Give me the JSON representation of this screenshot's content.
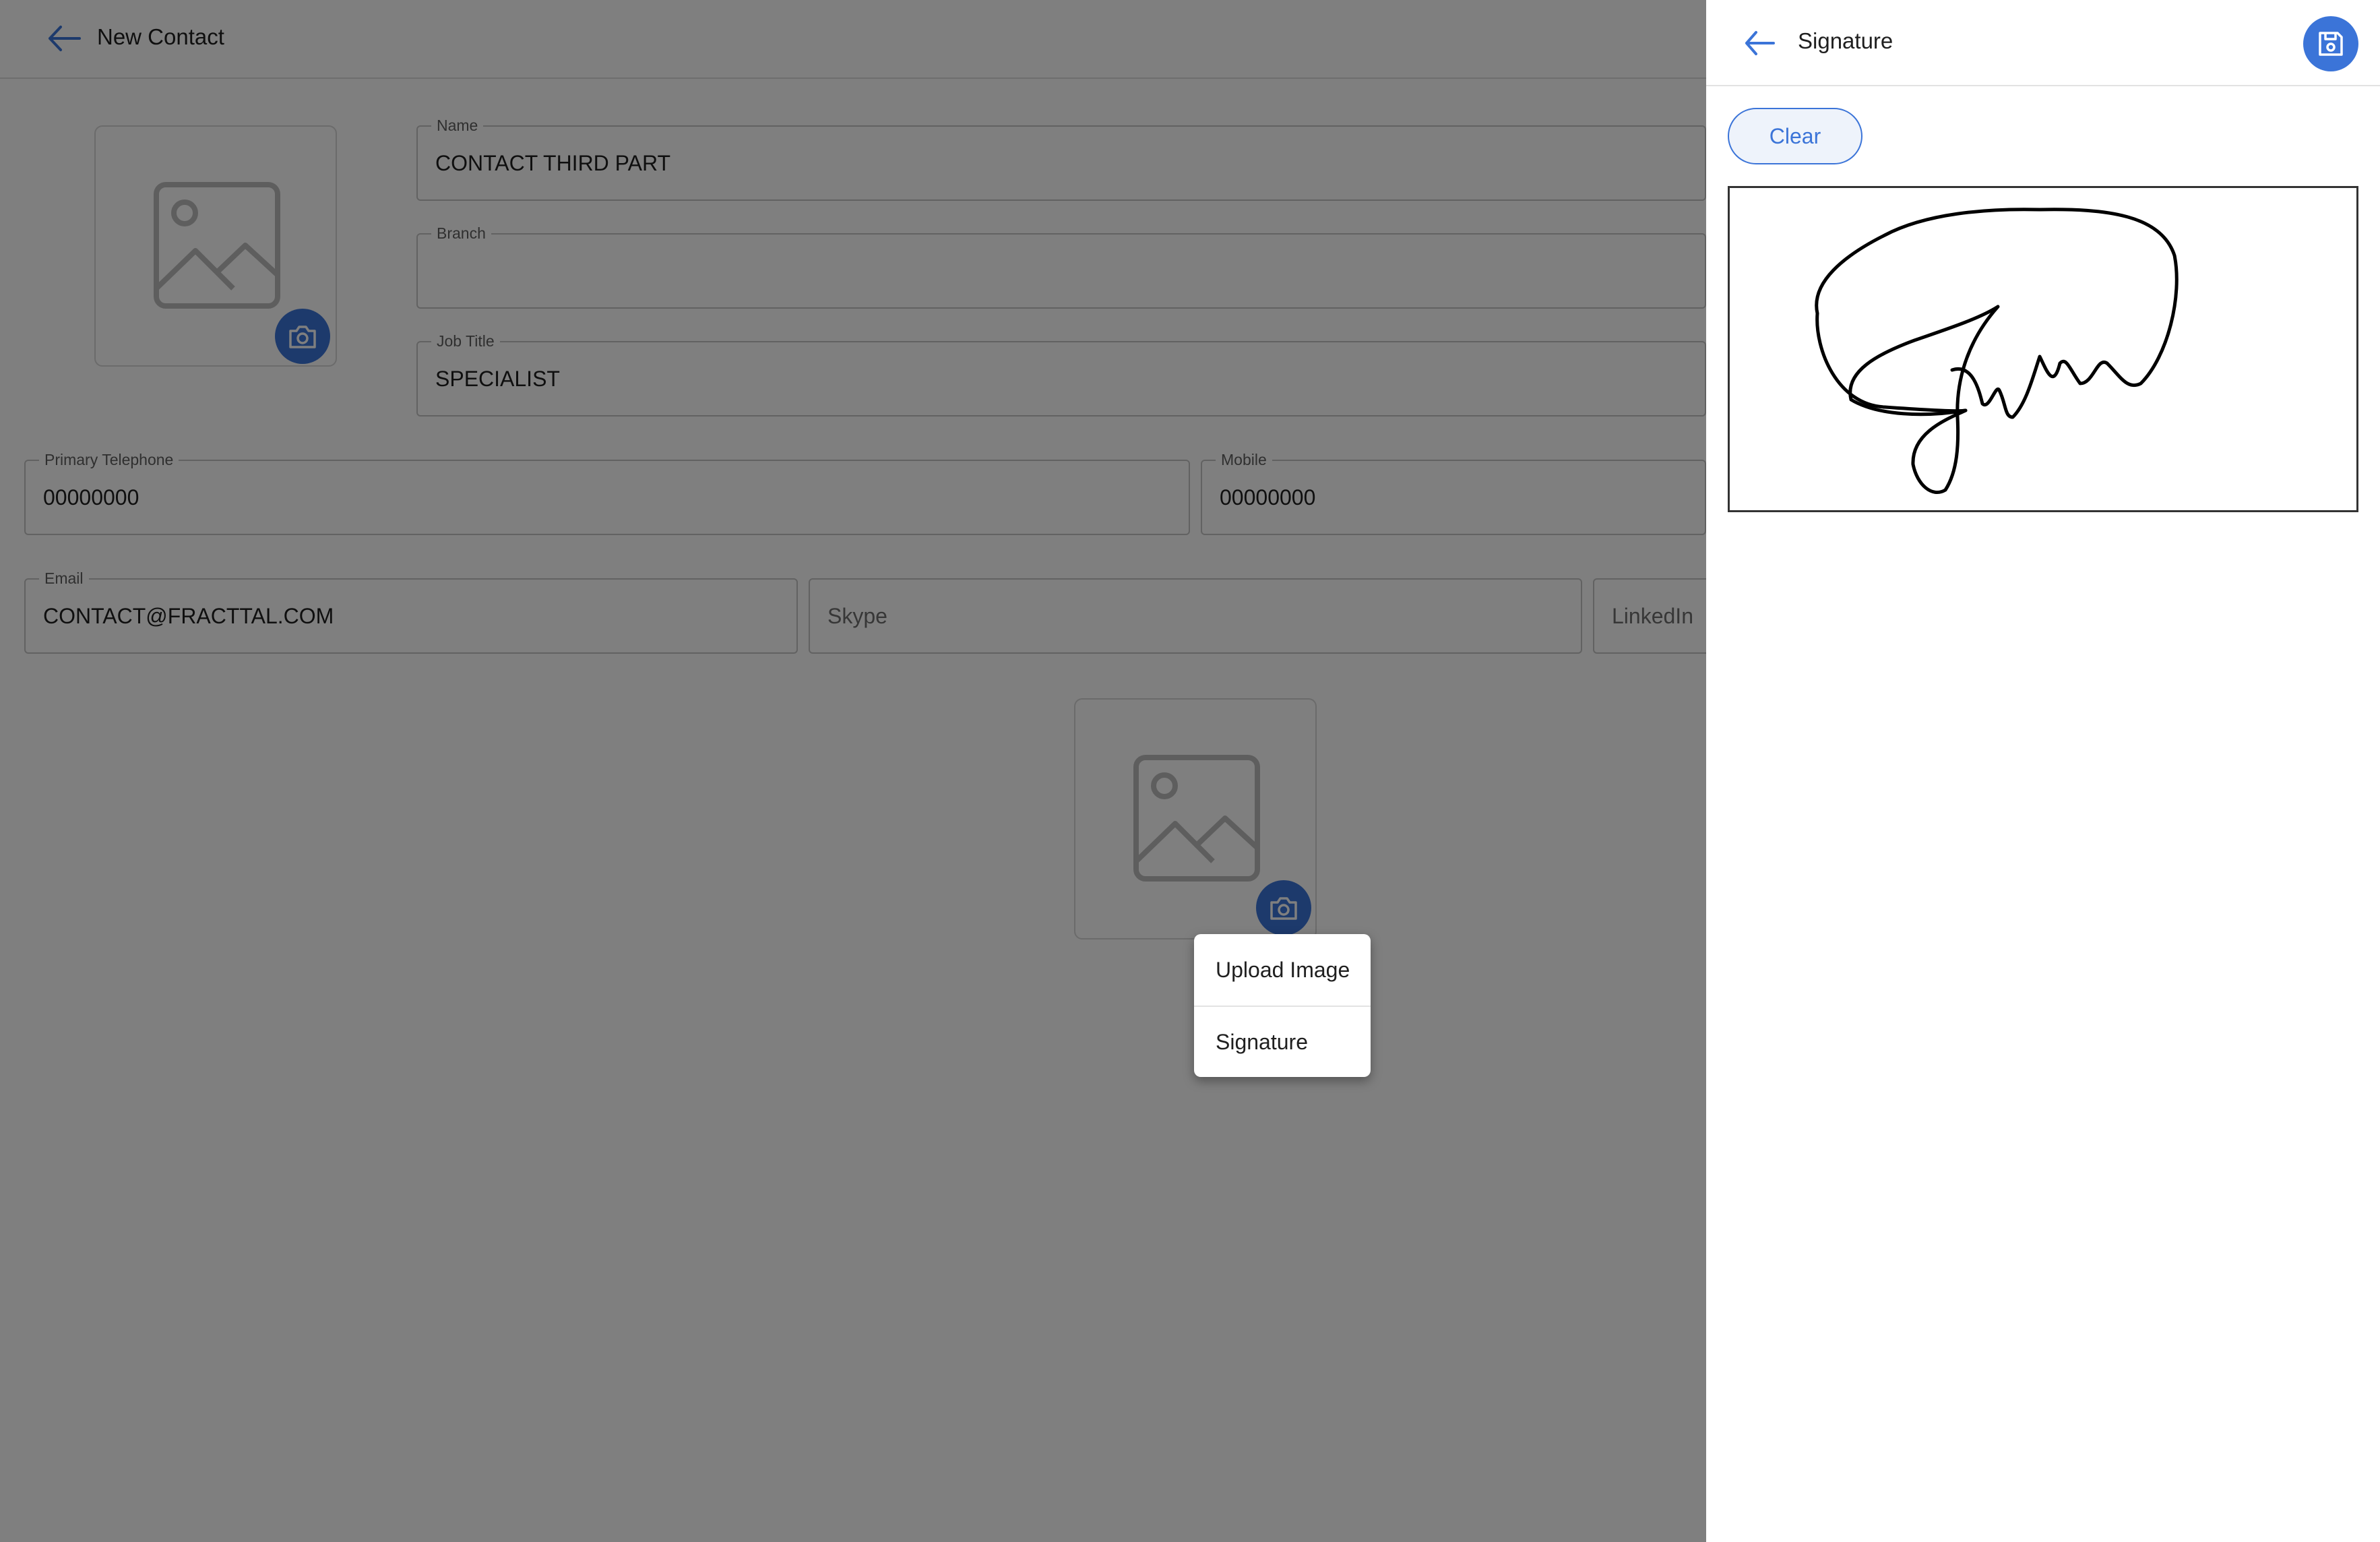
{
  "header": {
    "title": "New Contact",
    "back_icon": "arrow-left-icon"
  },
  "form": {
    "name": {
      "label": "Name",
      "value": "CONTACT THIRD PART"
    },
    "branch": {
      "label": "Branch",
      "value": ""
    },
    "job_title": {
      "label": "Job Title",
      "value": "SPECIALIST"
    },
    "primary_telephone": {
      "label": "Primary Telephone",
      "value": "00000000"
    },
    "mobile": {
      "label": "Mobile",
      "value": "00000000"
    },
    "email": {
      "label": "Email",
      "value": "CONTACT@FRACTTAL.COM"
    },
    "skype": {
      "placeholder": "Skype"
    },
    "linkedin": {
      "placeholder": "LinkedIn"
    }
  },
  "photo_menu": {
    "items": [
      {
        "label": "Upload Image"
      },
      {
        "label": "Signature"
      }
    ]
  },
  "signature_panel": {
    "title": "Signature",
    "back_icon": "arrow-left-icon",
    "save_icon": "save-icon",
    "clear_label": "Clear"
  },
  "colors": {
    "accent": "#3b74d8",
    "overlay": "rgba(0,0,0,0.5)"
  }
}
